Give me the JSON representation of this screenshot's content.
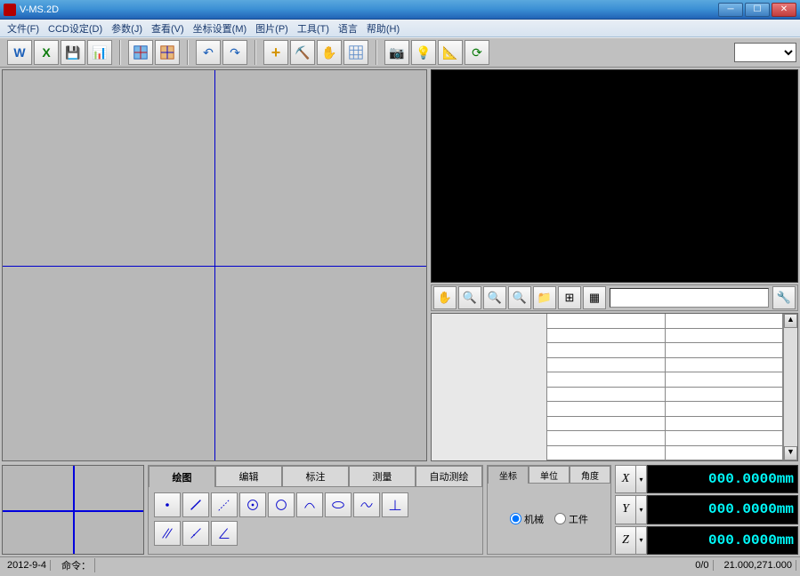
{
  "title": "V-MS.2D",
  "menu": [
    "文件(F)",
    "CCD设定(D)",
    "参数(J)",
    "查看(V)",
    "坐标设置(M)",
    "图片(P)",
    "工具(T)",
    "语言",
    "帮助(H)"
  ],
  "tabs": {
    "items": [
      "绘图",
      "编辑",
      "标注",
      "测量",
      "自动测绘"
    ],
    "active": 0
  },
  "coord_tabs": {
    "items": [
      "坐标",
      "单位",
      "角度"
    ],
    "active": 0
  },
  "coord_mode": {
    "opts": [
      "机械",
      "工件"
    ],
    "sel": 0
  },
  "axes": [
    {
      "label": "X",
      "value": "000.0000mm"
    },
    {
      "label": "Y",
      "value": "000.0000mm"
    },
    {
      "label": "Z",
      "value": "000.0000mm"
    }
  ],
  "status": {
    "date": "2012-9-4",
    "cmd_label": "命令：",
    "ratio": "0/0",
    "pos": "21.000,271.000"
  }
}
